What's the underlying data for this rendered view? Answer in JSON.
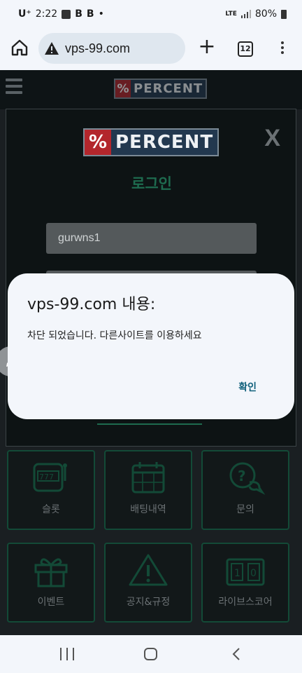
{
  "status_bar": {
    "carrier": "U⁺",
    "time": "2:22",
    "badge1": "B",
    "badge2": "B",
    "dot": "•",
    "network": "LTE",
    "battery": "80%"
  },
  "browser": {
    "url": "vps-99.com",
    "tab_count": "12"
  },
  "site": {
    "logo_pct": "%",
    "logo_name": "PERCENT",
    "login_title": "로그인",
    "close_label": "X",
    "username_value": "gurwns1",
    "menu_cards": [
      {
        "label": "슬롯",
        "icon": "slot-machine-icon"
      },
      {
        "label": "배팅내역",
        "icon": "calendar-icon"
      },
      {
        "label": "문의",
        "icon": "question-chat-icon"
      },
      {
        "label": "이벤트",
        "icon": "gift-icon"
      },
      {
        "label": "공지&규정",
        "icon": "warning-icon"
      },
      {
        "label": "라이브스코어",
        "icon": "scoreboard-icon"
      }
    ]
  },
  "dialog": {
    "title": "vps-99.com 내용:",
    "message": "차단 되었습니다. 다른사이트를 이용하세요",
    "ok_label": "확인"
  },
  "colors": {
    "accent_green": "#1e6b4f",
    "dialog_bg": "#f3f6fb",
    "ok_blue": "#0e5f7a",
    "logo_red": "#b3262c",
    "logo_navy": "#22384f"
  }
}
